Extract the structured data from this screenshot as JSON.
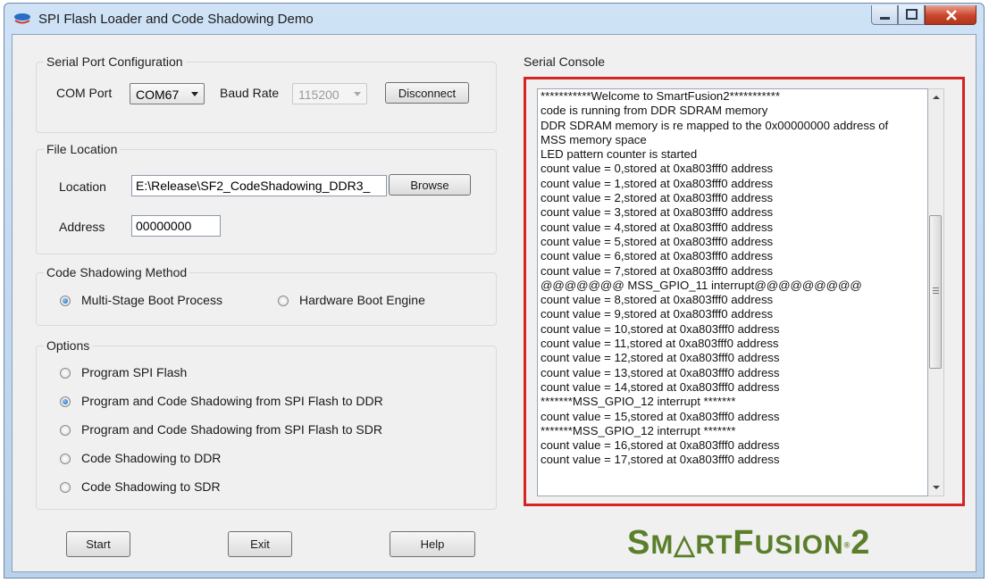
{
  "window": {
    "title": "SPI Flash Loader and Code Shadowing Demo"
  },
  "serial_port": {
    "group_label": "Serial Port Configuration",
    "com_port_label": "COM Port",
    "com_port_value": "COM67",
    "baud_rate_label": "Baud Rate",
    "baud_rate_value": "115200",
    "disconnect_label": "Disconnect"
  },
  "file_location": {
    "group_label": "File Location",
    "location_label": "Location",
    "location_value": "E:\\Release\\SF2_CodeShadowing_DDR3_",
    "browse_label": "Browse",
    "address_label": "Address",
    "address_value": "00000000"
  },
  "shadowing_method": {
    "group_label": "Code Shadowing Method",
    "options": [
      {
        "label": "Multi-Stage Boot Process",
        "checked": true
      },
      {
        "label": "Hardware Boot Engine",
        "checked": false
      }
    ]
  },
  "options": {
    "group_label": "Options",
    "items": [
      {
        "label": "Program SPI Flash",
        "checked": false
      },
      {
        "label": "Program and Code Shadowing from SPI Flash to DDR",
        "checked": true
      },
      {
        "label": "Program and Code Shadowing from SPI Flash to SDR",
        "checked": false
      },
      {
        "label": "Code Shadowing to DDR",
        "checked": false
      },
      {
        "label": "Code Shadowing to SDR",
        "checked": false
      }
    ]
  },
  "buttons": {
    "start": "Start",
    "exit": "Exit",
    "help": "Help"
  },
  "console": {
    "group_label": "Serial Console",
    "lines": [
      "***********Welcome to SmartFusion2***********",
      "code is running from DDR SDRAM memory",
      "DDR SDRAM memory is re mapped to the 0x00000000 address of",
      "MSS memory space",
      "LED pattern counter is started",
      "count value = 0,stored at 0xa803fff0 address",
      "count value = 1,stored at 0xa803fff0 address",
      "count value = 2,stored at 0xa803fff0 address",
      "count value = 3,stored at 0xa803fff0 address",
      "count value = 4,stored at 0xa803fff0 address",
      "count value = 5,stored at 0xa803fff0 address",
      "count value = 6,stored at 0xa803fff0 address",
      "count value = 7,stored at 0xa803fff0 address",
      "@@@@@@@ MSS_GPIO_11 interrupt@@@@@@@@@",
      "count value = 8,stored at 0xa803fff0 address",
      "count value = 9,stored at 0xa803fff0 address",
      "count value = 10,stored at 0xa803fff0 address",
      "count value = 11,stored at 0xa803fff0 address",
      "count value = 12,stored at 0xa803fff0 address",
      "count value = 13,stored at 0xa803fff0 address",
      "count value = 14,stored at 0xa803fff0 address",
      "*******MSS_GPIO_12 interrupt *******",
      "count value = 15,stored at 0xa803fff0 address",
      "*******MSS_GPIO_12 interrupt *******",
      "count value = 16,stored at 0xa803fff0 address",
      "count value = 17,stored at 0xa803fff0 address"
    ]
  },
  "logo": {
    "s": "S",
    "mart": "M△RT",
    "f": "F",
    "usion": "USION",
    "reg": "®",
    "two": "2"
  },
  "colors": {
    "console_highlight": "#d42424",
    "logo_green": "#5a7e2a"
  }
}
